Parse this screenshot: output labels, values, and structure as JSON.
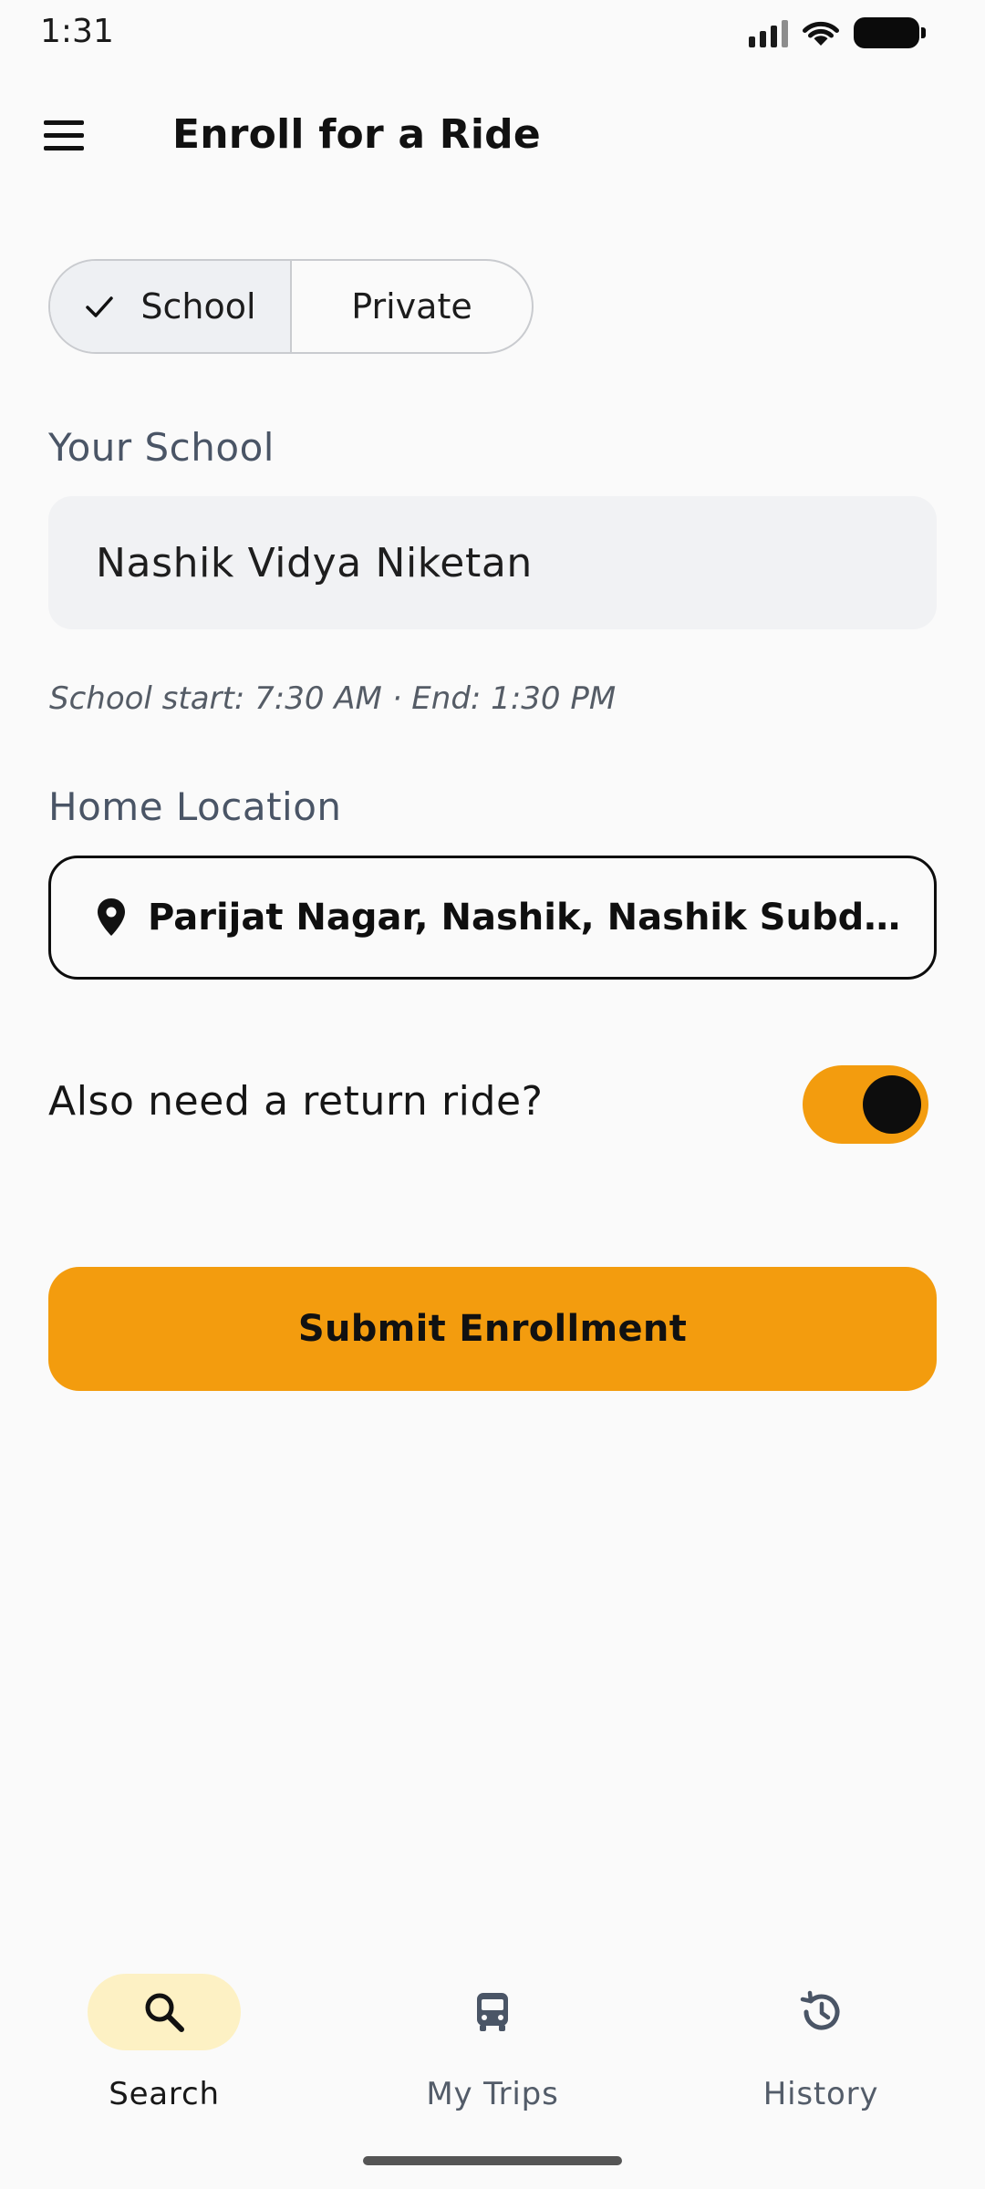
{
  "status_bar": {
    "time": "1:31"
  },
  "app_bar": {
    "title": "Enroll for a Ride",
    "menu_icon": "hamburger-menu-icon"
  },
  "ride_type": {
    "options": [
      {
        "label": "School",
        "selected": true
      },
      {
        "label": "Private",
        "selected": false
      }
    ]
  },
  "school": {
    "label": "Your School",
    "value": "Nashik Vidya Niketan",
    "hint": "School start: 7:30 AM · End: 1:30 PM"
  },
  "home_location": {
    "label": "Home Location",
    "value": "Parijat Nagar, Nashik, Nashik Subdistri…",
    "icon": "location-pin-icon"
  },
  "return_ride": {
    "label": "Also need a return ride?",
    "enabled": true
  },
  "submit": {
    "label": "Submit Enrollment"
  },
  "bottom_nav": {
    "items": [
      {
        "label": "Search",
        "icon": "search-icon",
        "active": true
      },
      {
        "label": "My Trips",
        "icon": "bus-icon",
        "active": false
      },
      {
        "label": "History",
        "icon": "history-icon",
        "active": false
      }
    ]
  },
  "colors": {
    "accent": "#f39c0e",
    "nav_active_pill": "#fdf1c4",
    "background": "#fafafa",
    "field_fill": "#f1f2f4"
  }
}
